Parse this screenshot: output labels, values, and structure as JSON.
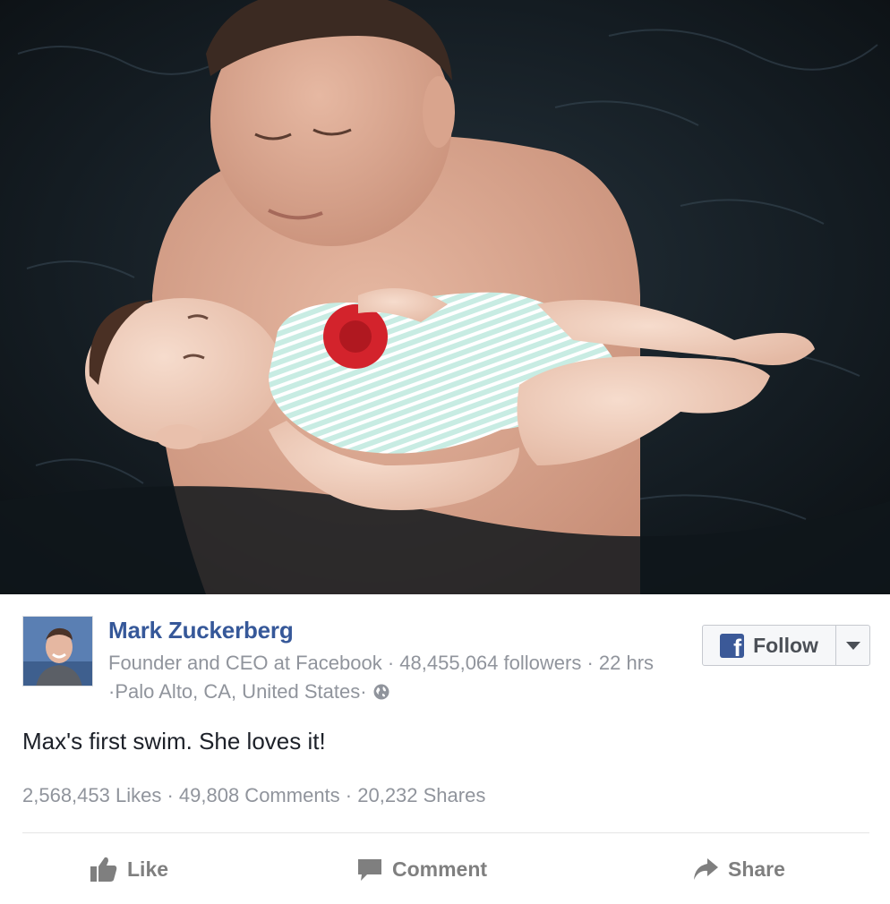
{
  "post": {
    "author_name": "Mark Zuckerberg",
    "author_title": "Founder and CEO at Facebook",
    "followers": "48,455,064 followers",
    "time": "22 hrs",
    "location": "Palo Alto, CA, United States",
    "message": "Max's first swim. She loves it!",
    "likes": "2,568,453 Likes",
    "comments": "49,808 Comments",
    "shares": "20,232 Shares",
    "separator": " · "
  },
  "follow": {
    "label": "Follow",
    "icon": "facebook-f-icon"
  },
  "actions": {
    "like_label": "Like",
    "comment_label": "Comment",
    "share_label": "Share"
  },
  "icons": {
    "globe": "globe-icon",
    "like": "thumbs-up-icon",
    "comment": "speech-bubble-icon",
    "share": "share-arrow-icon",
    "dropdown": "caret-down-icon"
  },
  "colors": {
    "author_link": "#365899",
    "meta_text": "#90949c",
    "brand": "#3b5998",
    "action_text": "#7f7f7f"
  }
}
